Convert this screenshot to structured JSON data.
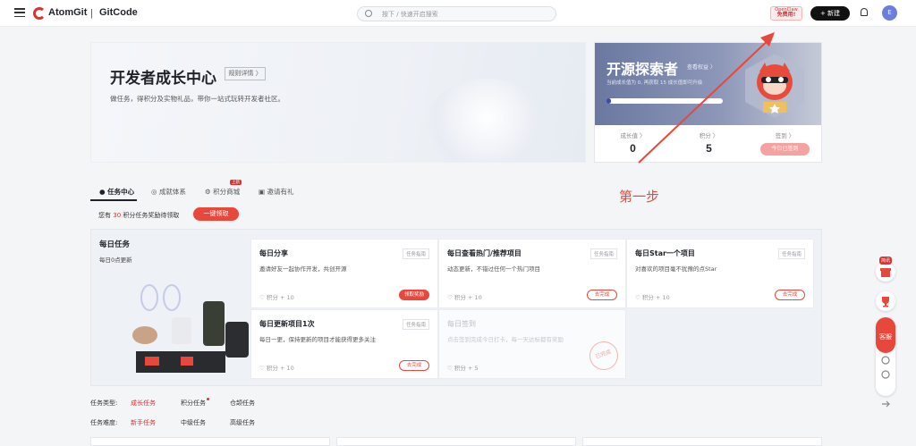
{
  "header": {
    "brand_primary": "AtomGit",
    "brand_sep": "|",
    "brand_secondary": "GitCode",
    "search_placeholder": "按下 / 快速开启搜索",
    "promo_line1": "OpenClaw",
    "promo_line2": "免费用!",
    "new_label": "+ 新建",
    "avatar_initial": "E"
  },
  "hero": {
    "title": "开发者成长中心",
    "rules_label": "规则详情 〉",
    "subtitle": "做任务，得积分及实物礼品，带你一站式玩转开发者社区。"
  },
  "explorer": {
    "title": "开源探索者",
    "link": "查看权益 〉",
    "desc": "当前成长值为 0, 再获取 15 成长值即可升级",
    "progress": 0.02,
    "stats": [
      {
        "label": "成长值 〉",
        "value": "0"
      },
      {
        "label": "积分 〉",
        "value": "5"
      },
      {
        "label": "签到 〉",
        "value": ""
      }
    ],
    "checkin_label": "今日已签到"
  },
  "annotation": {
    "step": "第一步"
  },
  "tabs": [
    {
      "label": "任务中心"
    },
    {
      "label": "成就体系"
    },
    {
      "label": "积分商城"
    },
    {
      "label": "邀请有礼"
    }
  ],
  "tab_badge": "上新",
  "reward": {
    "prefix": "您有",
    "count": "30",
    "suffix": "积分任务奖励待领取",
    "claim_label": "一键领取"
  },
  "daily": {
    "title": "每日任务",
    "subtitle": "每日0点更新",
    "tasks": [
      {
        "title": "每日分享",
        "tag": "任务指南",
        "desc": "邀请好友一起协作开发，共创开源",
        "points": "积分 + 10",
        "action": "领取奖励"
      },
      {
        "title": "每日查看热门/推荐项目",
        "tag": "任务指南",
        "desc": "动态更新，不错过任何一个热门项目",
        "points": "积分 + 10",
        "action": "去完成"
      },
      {
        "title": "每日Star一个项目",
        "tag": "任务指南",
        "desc": "对喜欢的项目毫不犹豫的点Star",
        "points": "积分 + 10",
        "action": "去完成"
      },
      {
        "title": "每日更新项目1次",
        "tag": "任务指南",
        "desc": "每日一更，保持更新的项目才能获得更多关注",
        "points": "积分 + 10",
        "action": "去完成"
      },
      {
        "title": "每日签到",
        "tag": "",
        "desc": "点击签到完成今日打卡，每一天达标都有奖励",
        "points": "积分 + 5",
        "action": "已完成"
      }
    ]
  },
  "filters": {
    "type_label": "任务类型:",
    "type_options": [
      "成长任务",
      "积分任务",
      "仓颉任务"
    ],
    "level_label": "任务难度:",
    "level_options": [
      "新手任务",
      "中级任务",
      "高级任务"
    ]
  },
  "float": {
    "tag": "简讯",
    "help_label": "客服"
  }
}
